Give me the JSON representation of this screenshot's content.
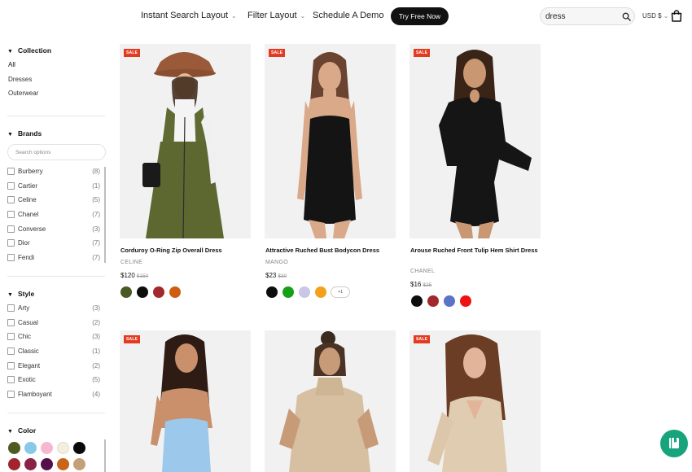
{
  "nav": {
    "items": [
      {
        "label": "Instant Search Layout",
        "has_caret": true
      },
      {
        "label": "Filter Layout",
        "has_caret": true
      },
      {
        "label": "Schedule A Demo",
        "has_caret": false
      }
    ],
    "cta_label": "Try Free Now",
    "search_value": "dress",
    "search_icon": "search-icon",
    "currency": "USD $",
    "caret": "⌄",
    "cart_icon": "shopping-bag-icon"
  },
  "sidebar": {
    "collection": {
      "title": "Collection",
      "items": [
        "All",
        "Dresses",
        "Outerwear"
      ]
    },
    "brands": {
      "title": "Brands",
      "search_placeholder": "Search options",
      "items": [
        {
          "label": "Burberry",
          "count": "(8)"
        },
        {
          "label": "Cartier",
          "count": "(1)"
        },
        {
          "label": "Celine",
          "count": "(5)"
        },
        {
          "label": "Chanel",
          "count": "(7)"
        },
        {
          "label": "Converse",
          "count": "(3)"
        },
        {
          "label": "Dior",
          "count": "(7)"
        },
        {
          "label": "Fendi",
          "count": "(7)"
        }
      ]
    },
    "style": {
      "title": "Style",
      "items": [
        {
          "label": "Arty",
          "count": "(3)"
        },
        {
          "label": "Casual",
          "count": "(2)"
        },
        {
          "label": "Chic",
          "count": "(3)"
        },
        {
          "label": "Classic",
          "count": "(1)"
        },
        {
          "label": "Elegant",
          "count": "(2)"
        },
        {
          "label": "Exotic",
          "count": "(5)"
        },
        {
          "label": "Flamboyant",
          "count": "(4)"
        }
      ]
    },
    "color": {
      "title": "Color",
      "swatches": [
        "#4d5b22",
        "#87c9e8",
        "#f6b7cf",
        "#f3eede",
        "#0a0a0a",
        "#a1242c",
        "#8a2243",
        "#55104b",
        "#c7651a",
        "#c4a079",
        "#1f3cf0",
        "#1e6f2e"
      ]
    }
  },
  "products": [
    {
      "name": "Corduroy O-Ring Zip Overall Dress",
      "brand": "CELINE",
      "price": "$120",
      "old_price": "$150",
      "badge": "SALE",
      "colors": [
        "#4a5a23",
        "#0d0d0d",
        "#a3282b",
        "#cf5d10"
      ],
      "more": ""
    },
    {
      "name": "Attractive Ruched Bust Bodycon Dress",
      "brand": "MANGO",
      "price": "$23",
      "old_price": "$30",
      "badge": "SALE",
      "colors": [
        "#0d0d0d",
        "#14a018",
        "#c9c6e8",
        "#f4a11a"
      ],
      "more": "+1"
    },
    {
      "name": "Arouse Ruched Front Tulip Hem Shirt Dress",
      "brand": "CHANEL",
      "price": "$16",
      "old_price": "$25",
      "badge": "SALE",
      "colors": [
        "#0d0d0d",
        "#a3282b",
        "#5a74c8",
        "#ee1313"
      ],
      "more": ""
    },
    {
      "name": "",
      "brand": "",
      "price": "",
      "old_price": "",
      "badge": "SALE",
      "colors": [],
      "more": ""
    },
    {
      "name": "",
      "brand": "",
      "price": "",
      "old_price": "",
      "badge": "",
      "colors": [],
      "more": ""
    },
    {
      "name": "",
      "brand": "",
      "price": "",
      "old_price": "",
      "badge": "SALE",
      "colors": [],
      "more": ""
    }
  ],
  "chat_icon": "chat-book-icon"
}
